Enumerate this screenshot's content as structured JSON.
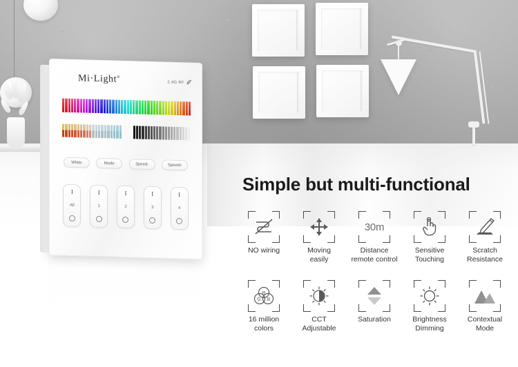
{
  "scene": {
    "background": {
      "wall_color": "#a9a9a9",
      "floor_color": "#ffffff",
      "objects": [
        {
          "name": "pendant-lamp",
          "count": 2
        },
        {
          "name": "wall-art-panel",
          "count": 4
        },
        {
          "name": "floor-lamp",
          "count": 1
        },
        {
          "name": "decorative-plant",
          "count": 1
        }
      ]
    }
  },
  "product": {
    "brand": "Mi·Light",
    "trademark": "®",
    "rf_label": "2.4G RF",
    "sliders": [
      {
        "name": "rgb-color-strip",
        "type": "hue",
        "segments": 44
      },
      {
        "name": "cct-strip",
        "type": "color-temperature",
        "segments": 20
      },
      {
        "name": "brightness-strip",
        "type": "brightness",
        "segments": 20
      }
    ],
    "function_buttons": [
      {
        "label": "White"
      },
      {
        "label": "Mode"
      },
      {
        "label": "Speed-"
      },
      {
        "label": "Speed+"
      }
    ],
    "zone_buttons": [
      {
        "label": "All",
        "on": "I",
        "off": "○"
      },
      {
        "label": "1",
        "on": "I",
        "off": "○"
      },
      {
        "label": "2",
        "on": "I",
        "off": "○"
      },
      {
        "label": "3",
        "on": "I",
        "off": "○"
      },
      {
        "label": "4",
        "on": "I",
        "off": "○"
      }
    ]
  },
  "marketing": {
    "headline": "Simple but multi-functional",
    "features_row1": [
      {
        "icon": "no-wiring-icon",
        "label": "NO wiring"
      },
      {
        "icon": "move-arrows-icon",
        "label": "Moving\neasily"
      },
      {
        "icon": "distance-30m-icon",
        "label": "Distance\nremote control",
        "value": "30m"
      },
      {
        "icon": "touch-hand-icon",
        "label": "Sensitive\nTouching"
      },
      {
        "icon": "pencil-scratch-icon",
        "label": "Scratch\nResistance"
      }
    ],
    "features_row2": [
      {
        "icon": "rgb-venn-icon",
        "label": "16 million\ncolors",
        "circles": [
          "R",
          "G",
          "B"
        ]
      },
      {
        "icon": "cct-sun-icon",
        "label": "CCT\nAdjustable"
      },
      {
        "icon": "saturation-triangles-icon",
        "label": "Saturation"
      },
      {
        "icon": "brightness-sun-icon",
        "label": "Brightness\nDimming"
      },
      {
        "icon": "mountains-icon",
        "label": "Contextual\nMode"
      }
    ]
  }
}
